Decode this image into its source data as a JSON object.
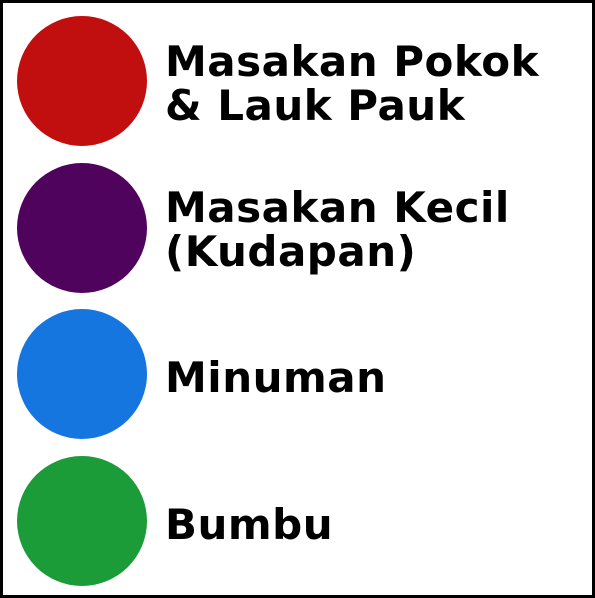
{
  "legend": {
    "items": [
      {
        "color": "#c10e0e",
        "lines": [
          "Masakan Pokok",
          "& Lauk Pauk"
        ]
      },
      {
        "color": "#50035c",
        "lines": [
          "Masakan Kecil",
          "(Kudapan)"
        ]
      },
      {
        "color": "#1676e0",
        "lines": [
          "Minuman"
        ]
      },
      {
        "color": "#1c9b39",
        "lines": [
          "Bumbu"
        ]
      }
    ]
  }
}
